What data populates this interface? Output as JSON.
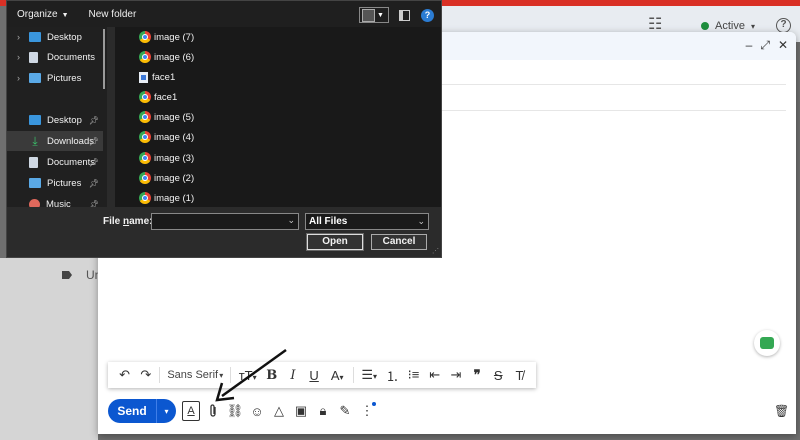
{
  "background": {
    "active_status": "Active",
    "help_icon_glyph": "?",
    "label_text": "Un"
  },
  "dialog": {
    "toolbar": {
      "organize": "Organize",
      "new_folder": "New folder"
    },
    "nav": [
      {
        "label": "Desktop",
        "icon": "desktop-icon",
        "chevron": true,
        "pinned": false
      },
      {
        "label": "Documents",
        "icon": "documents-icon",
        "chevron": true,
        "pinned": false
      },
      {
        "label": "Pictures",
        "icon": "pictures-icon",
        "chevron": true,
        "pinned": false
      },
      {
        "label": "Desktop",
        "icon": "desktop-icon",
        "chevron": false,
        "pinned": true
      },
      {
        "label": "Downloads",
        "icon": "downloads-icon",
        "chevron": false,
        "pinned": true,
        "selected": true
      },
      {
        "label": "Documents",
        "icon": "documents-icon",
        "chevron": false,
        "pinned": true
      },
      {
        "label": "Pictures",
        "icon": "pictures-icon",
        "chevron": false,
        "pinned": true
      },
      {
        "label": "Music",
        "icon": "music-icon",
        "chevron": false,
        "pinned": true
      }
    ],
    "files": [
      {
        "name": "image (7)",
        "icon": "chrome-icon"
      },
      {
        "name": "image (6)",
        "icon": "chrome-icon"
      },
      {
        "name": "face1",
        "icon": "document-file-icon"
      },
      {
        "name": "face1",
        "icon": "chrome-icon"
      },
      {
        "name": "image (5)",
        "icon": "chrome-icon"
      },
      {
        "name": "image (4)",
        "icon": "chrome-icon"
      },
      {
        "name": "image (3)",
        "icon": "chrome-icon"
      },
      {
        "name": "image (2)",
        "icon": "chrome-icon"
      },
      {
        "name": "image (1)",
        "icon": "chrome-icon"
      }
    ],
    "file_name_label_pre": "File ",
    "file_name_label_ul": "n",
    "file_name_label_post": "ame:",
    "file_name_value": "",
    "file_type": "All Files",
    "open_label": "Open",
    "cancel_label": "Cancel"
  },
  "compose": {
    "font_family": "Sans Serif",
    "send_label": "Send",
    "colors": {
      "send": "#0b57d0",
      "top_bar": "#d93025"
    }
  }
}
